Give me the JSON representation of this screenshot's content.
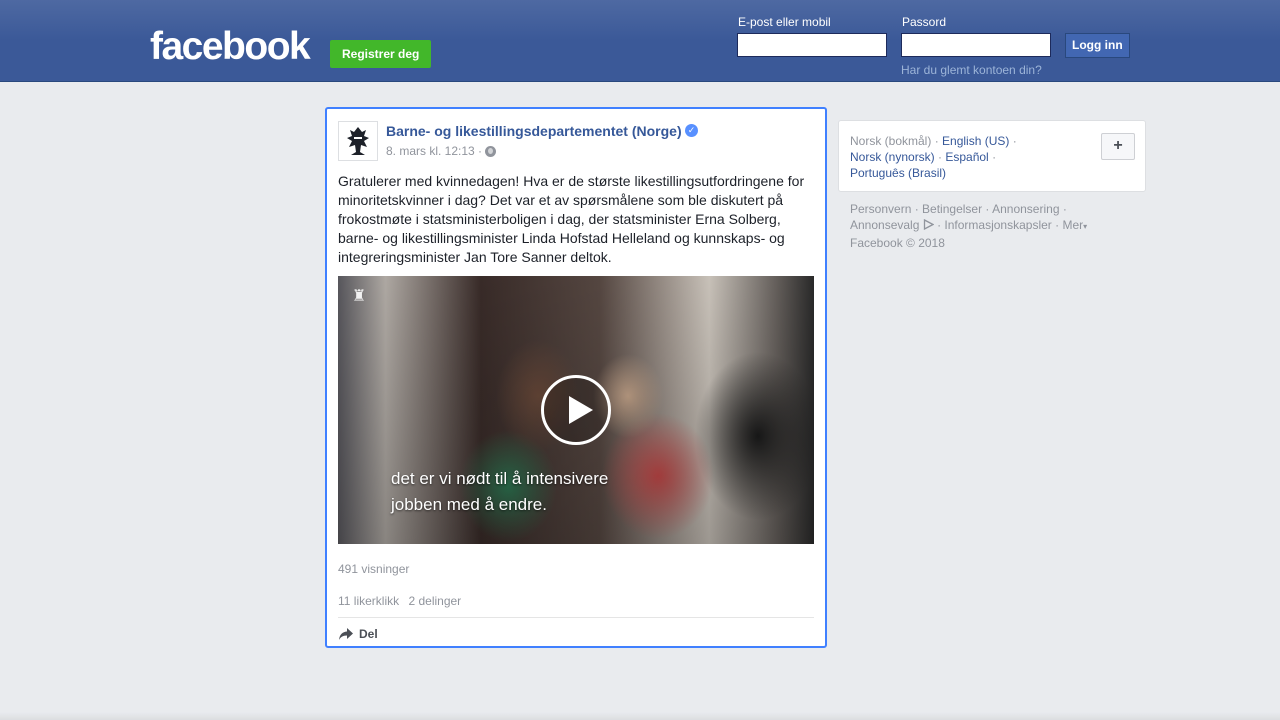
{
  "header": {
    "logo_text": "facebook",
    "register_label": "Registrer deg",
    "email_label": "E-post eller mobil",
    "password_label": "Passord",
    "email_value": "",
    "password_value": "",
    "login_label": "Logg inn",
    "forgot_link": "Har du glemt kontoen din?",
    "brand_color": "#3b5998",
    "register_color": "#42b72a"
  },
  "post": {
    "page_name": "Barne- og likestillingsdepartementet (Norge)",
    "verified_icon": "verified-badge-icon",
    "timestamp": "8. mars kl. 12:13 ·",
    "audience_icon": "globe-icon",
    "text": "Gratulerer med kvinnedagen! Hva er de største likestillingsutfordringene for minoritetskvinner i dag? Det var et av spørsmålene som ble diskutert på frokostmøte i statsministerboligen i dag, der statsminister Erna Solberg, barne- og likestillingsminister Linda Hofstad Helleland og kunnskaps- og integreringsminister Jan Tore Sanner deltok.",
    "video_subtitle_line1": "det er vi nødt til å intensivere",
    "video_subtitle_line2": "jobben med å endre.",
    "views": "491 visninger",
    "likes": "11 likerklikk",
    "shares": "2 delinger",
    "share_label": "Del"
  },
  "sidebar": {
    "languages": [
      {
        "label": "Norsk (bokmål)",
        "current": true
      },
      {
        "label": "English (US)",
        "current": false
      },
      {
        "label": "Norsk (nynorsk)",
        "current": false
      },
      {
        "label": "Español",
        "current": false
      },
      {
        "label": "Português (Brasil)",
        "current": false
      }
    ],
    "add_language_label": "+",
    "footer_links": [
      "Personvern",
      "Betingelser",
      "Annonsering",
      "Annonsevalg",
      "Informasjonskapsler",
      "Mer"
    ],
    "copyright": "Facebook © 2018"
  }
}
